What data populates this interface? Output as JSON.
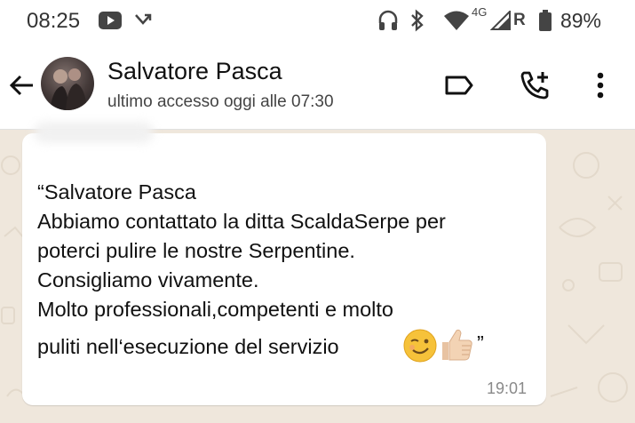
{
  "status_bar": {
    "time": "08:25",
    "network_label": "4G",
    "roaming_label": "R",
    "battery": "89%"
  },
  "header": {
    "contact_name": "Salvatore Pasca",
    "last_seen": "ultimo accesso oggi alle 07:30",
    "icons": [
      "back-arrow-icon",
      "label-icon",
      "add-call-icon",
      "more-options-icon"
    ]
  },
  "message": {
    "lines": [
      "“Salvatore Pasca",
      "Abbiamo contattato la ditta ScaldaSerpe per",
      "poterci pulire le nostre Serpentine.",
      "Consigliamo vivamente.",
      "Molto professionali,competenti e molto",
      "puliti nell‘esecuzione del servizio"
    ],
    "closing_quote": "”",
    "emojis": [
      "winking-face-emoji",
      "thumbs-up-emoji"
    ],
    "time": "19:01"
  },
  "colors": {
    "chat_background": "#efe7dc",
    "bubble": "#ffffff",
    "header": "#ffffff"
  }
}
